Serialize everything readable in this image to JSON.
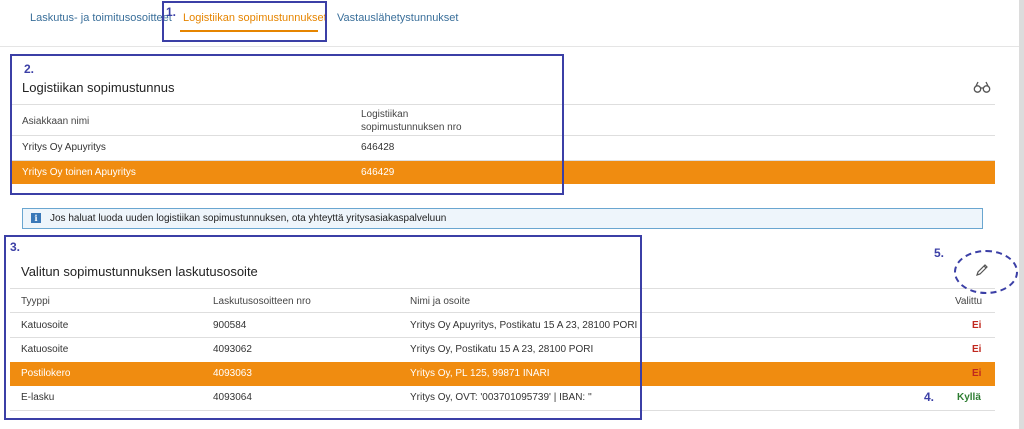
{
  "tabs": [
    {
      "label": "Laskutus- ja toimitusosoitteet"
    },
    {
      "label": "Logistiikan sopimustunnukset"
    },
    {
      "label": "Vastauslähetystunnukset"
    }
  ],
  "annotations": [
    "1.",
    "2.",
    "3.",
    "4.",
    "5."
  ],
  "contract_section": {
    "title": "Logistiikan sopimustunnus",
    "columns": [
      "Asiakkaan nimi",
      "Logistiikan sopimustunnuksen nro"
    ],
    "rows": [
      {
        "name": "Yritys Oy Apuyritys",
        "number": "646428"
      },
      {
        "name": "Yritys Oy toinen Apuyritys",
        "number": "646429"
      }
    ]
  },
  "info_message": "Jos haluat luoda uuden logistiikan sopimustunnuksen, ota yhteyttä yritysasiakaspalveluun",
  "billing_section": {
    "title": "Valitun sopimustunnuksen laskutusosoite",
    "columns": [
      "Tyyppi",
      "Laskutusosoitteen nro",
      "Nimi ja osoite",
      "Valittu"
    ],
    "rows": [
      {
        "type": "Katuosoite",
        "number": "900584",
        "address": "Yritys Oy Apuyritys, Postikatu 15 A 23, 28100 PORI",
        "selected": "Ei"
      },
      {
        "type": "Katuosoite",
        "number": "4093062",
        "address": "Yritys Oy, Postikatu 15 A 23, 28100 PORI",
        "selected": "Ei"
      },
      {
        "type": "Postilokero",
        "number": "4093063",
        "address": "Yritys Oy, PL 125, 99871 INARI",
        "selected": "Ei"
      },
      {
        "type": "E-lasku",
        "number": "4093064",
        "address": "Yritys Oy, OVT: '003701095739' | IBAN: ''",
        "selected": "Kyllä"
      }
    ]
  },
  "icons": {
    "search": "binoculars-icon",
    "edit": "pencil-icon",
    "info": "info-icon"
  },
  "colors": {
    "accent": "#f08c10",
    "link": "#3a6f9a",
    "annotation": "#3b3fa6",
    "no": "#c0281e",
    "yes": "#2e7d32"
  }
}
